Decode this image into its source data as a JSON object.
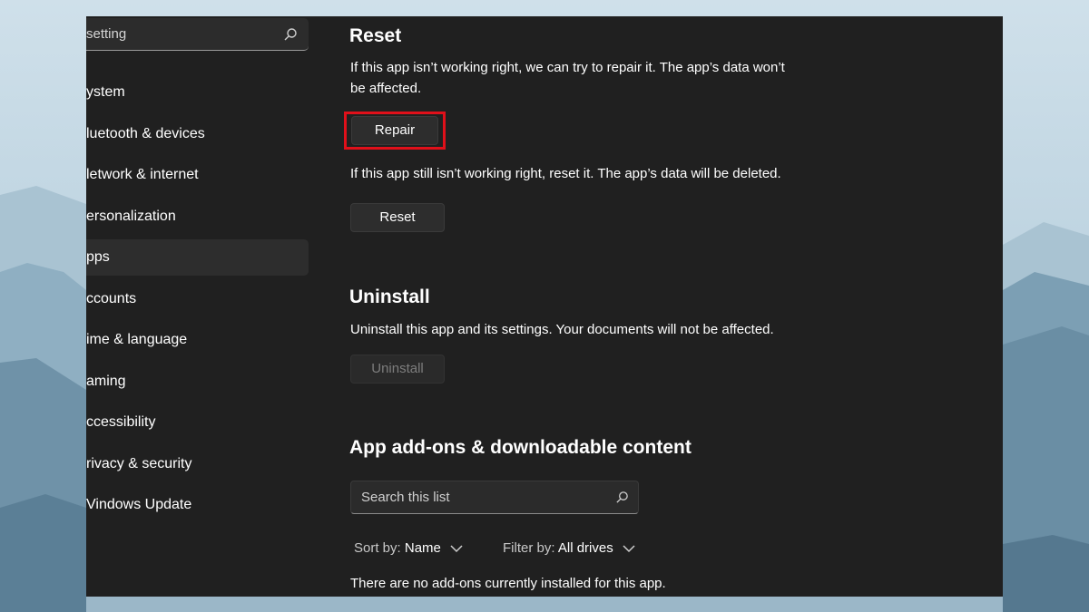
{
  "background_colors": {
    "sky": "#c7dbe6",
    "mountains": "#6e90a5"
  },
  "sidebar": {
    "search": {
      "value": "setting",
      "icon": "search-icon"
    },
    "items": [
      {
        "label": "ystem"
      },
      {
        "label": "luetooth & devices"
      },
      {
        "label": "letwork & internet"
      },
      {
        "label": "ersonalization"
      },
      {
        "label": "pps",
        "active": true
      },
      {
        "label": "ccounts"
      },
      {
        "label": "ime & language"
      },
      {
        "label": "aming"
      },
      {
        "label": "ccessibility"
      },
      {
        "label": "rivacy & security"
      },
      {
        "label": "Vindows Update"
      }
    ]
  },
  "main": {
    "reset": {
      "heading": "Reset",
      "repair_description": "If this app isn’t working right, we can try to repair it. The app’s data won’t be affected.",
      "repair_button": "Repair",
      "reset_description": "If this app still isn’t working right, reset it. The app’s data will be deleted.",
      "reset_button": "Reset"
    },
    "uninstall": {
      "heading": "Uninstall",
      "description": "Uninstall this app and its settings. Your documents will not be affected.",
      "button": "Uninstall"
    },
    "addons": {
      "heading": "App add-ons & downloadable content",
      "search_placeholder": "Search this list",
      "sort_label": "Sort by:",
      "sort_value": "Name",
      "filter_label": "Filter by:",
      "filter_value": "All drives",
      "empty_message": "There are no add-ons currently installed for this app."
    }
  },
  "colors": {
    "highlight": "#e0101a",
    "window_bg": "#202020",
    "button_bg": "#2d2d2d"
  }
}
